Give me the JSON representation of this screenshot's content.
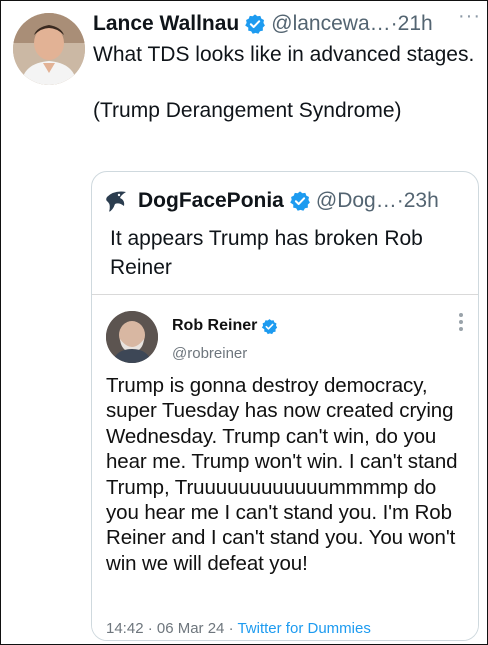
{
  "tweet": {
    "author_name": "Lance Wallnau",
    "handle": "@lancewa…",
    "time": "·21h",
    "more": "···",
    "text": "What TDS looks like in advanced stages.\n\n(Trump Derangement Syndrome)"
  },
  "quote": {
    "author_name": "DogFacePonia",
    "handle": "@Dog…",
    "time": "·23h",
    "text": "It appears Trump has broken Rob Reiner"
  },
  "screenshot": {
    "author_name": "Rob Reiner",
    "handle": "@robreiner",
    "text": "Trump is gonna destroy democracy, super Tuesday has now created crying Wednesday. Trump can't win, do you hear me. Trump won't win. I can't stand Trump, Truuuuuuuuuuuummmmp do you hear me I can't stand you. I'm Rob Reiner and I can't stand you. You won't win we will defeat you!",
    "timestamp": "14:42 · 06 Mar 24 · ",
    "source": "Twitter for Dummies"
  },
  "colors": {
    "verified": "#1d9bf0",
    "secondary_text": "#536471",
    "link": "#1d9bf0"
  },
  "icons": {
    "verified": "verified-badge-icon",
    "more": "more-options-icon"
  }
}
